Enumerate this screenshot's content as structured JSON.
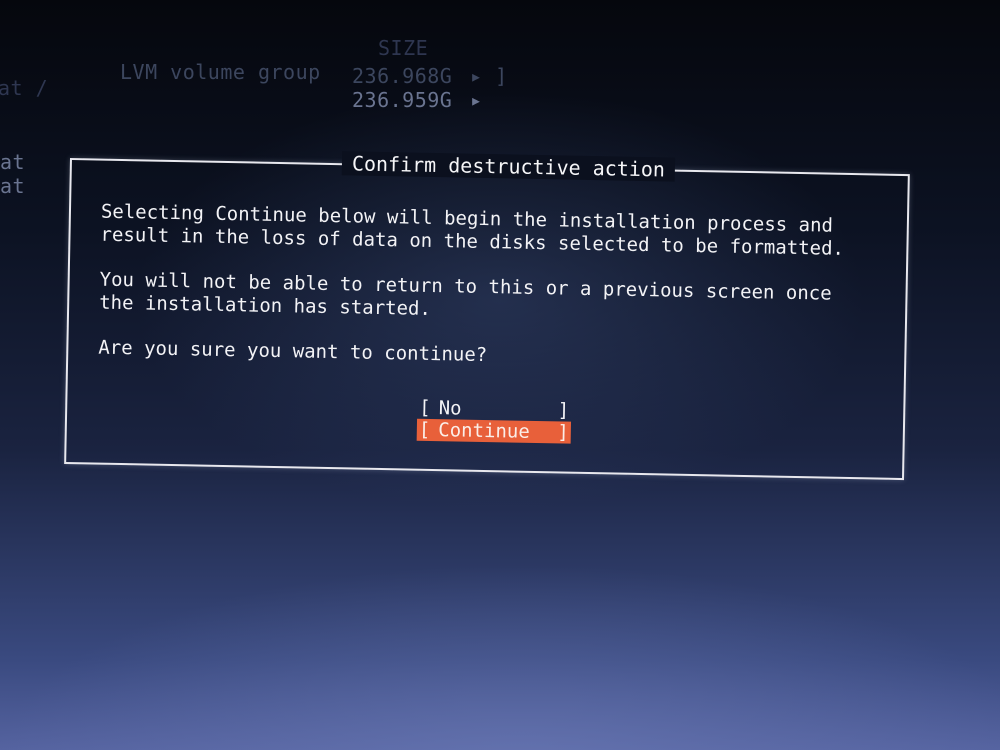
{
  "background": {
    "size_header": "SIZE",
    "row1_label": "LVM volume group",
    "row1_size": "236.968G",
    "row1_arrow": "▸ ]",
    "row2_size": "236.959G",
    "row2_arrow": "▸",
    "left_fragment_1": "at /",
    "left_fragment_2": "at",
    "left_fragment_3": "at"
  },
  "dialog": {
    "title": "Confirm destructive action",
    "paragraph_1": "Selecting Continue below will begin the installation process and result in the loss of data on the disks selected to be formatted.",
    "paragraph_2": "You will not be able to return to this or a previous screen once the installation has started.",
    "question": "Are you sure you want to continue?",
    "buttons": [
      {
        "open": "[",
        "label": "No",
        "close": "]",
        "selected": false
      },
      {
        "open": "[",
        "label": "Continue",
        "close": "]",
        "selected": true
      }
    ]
  },
  "colors": {
    "highlight": "#e8603a",
    "text": "#f3f3f6",
    "frame": "#e8e8ee"
  }
}
